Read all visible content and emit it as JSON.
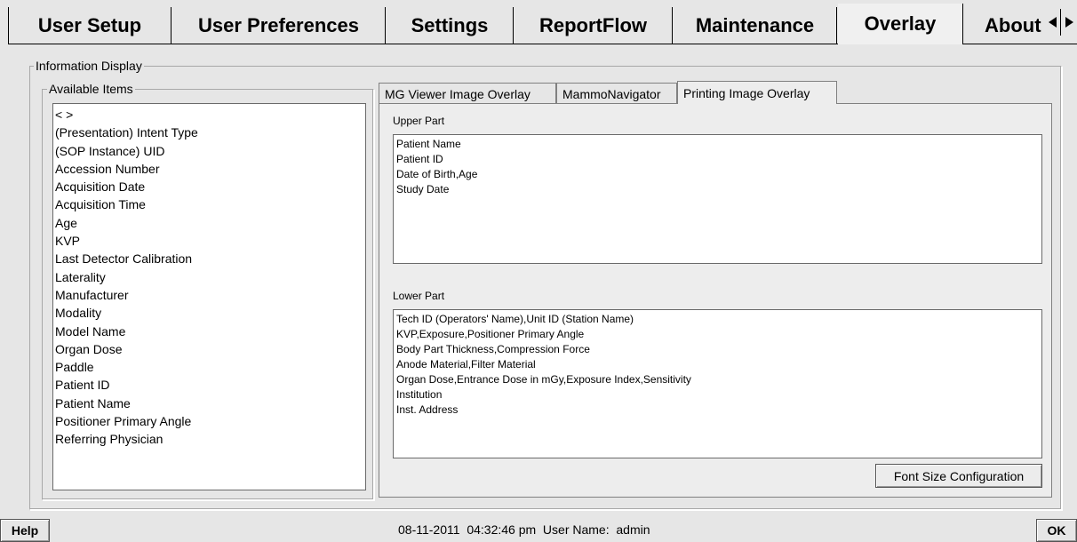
{
  "main_tabs": [
    {
      "label": "User Setup"
    },
    {
      "label": "User Preferences"
    },
    {
      "label": "Settings"
    },
    {
      "label": "ReportFlow"
    },
    {
      "label": "Maintenance"
    },
    {
      "label": "Overlay",
      "active": true
    },
    {
      "label": "About"
    }
  ],
  "scroll": {
    "left_icon": "triangle-left-icon",
    "right_icon": "triangle-right-icon"
  },
  "info_display": {
    "title": "Information Display",
    "available": {
      "title": "Available Items",
      "items": [
        "< >",
        "(Presentation) Intent Type",
        "(SOP Instance) UID",
        "Accession Number",
        "Acquisition Date",
        "Acquisition Time",
        "Age",
        "KVP",
        "Last Detector Calibration",
        "Laterality",
        "Manufacturer",
        "Modality",
        "Model Name",
        "Organ Dose",
        "Paddle",
        "Patient ID",
        "Patient Name",
        "Positioner Primary Angle",
        "Referring Physician"
      ]
    },
    "sub_tabs": [
      {
        "label": "MG Viewer Image Overlay"
      },
      {
        "label": "MammoNavigator"
      },
      {
        "label": "Printing Image Overlay",
        "active": true
      }
    ],
    "upper": {
      "label": "Upper Part",
      "lines": [
        "Patient Name",
        "Patient ID",
        "Date of Birth,Age",
        "Study Date"
      ]
    },
    "lower": {
      "label": "Lower Part",
      "lines": [
        "Tech ID (Operators' Name),Unit ID (Station Name)",
        "KVP,Exposure,Positioner Primary Angle",
        "Body Part Thickness,Compression Force",
        "Anode Material,Filter Material",
        "Organ Dose,Entrance Dose in mGy,Exposure Index,Sensitivity",
        "Institution",
        "Inst. Address"
      ]
    },
    "font_button": "Font Size Configuration"
  },
  "status": {
    "help": "Help",
    "text": "08-11-2011  04:32:46 pm  User Name:  admin",
    "ok": "OK"
  }
}
